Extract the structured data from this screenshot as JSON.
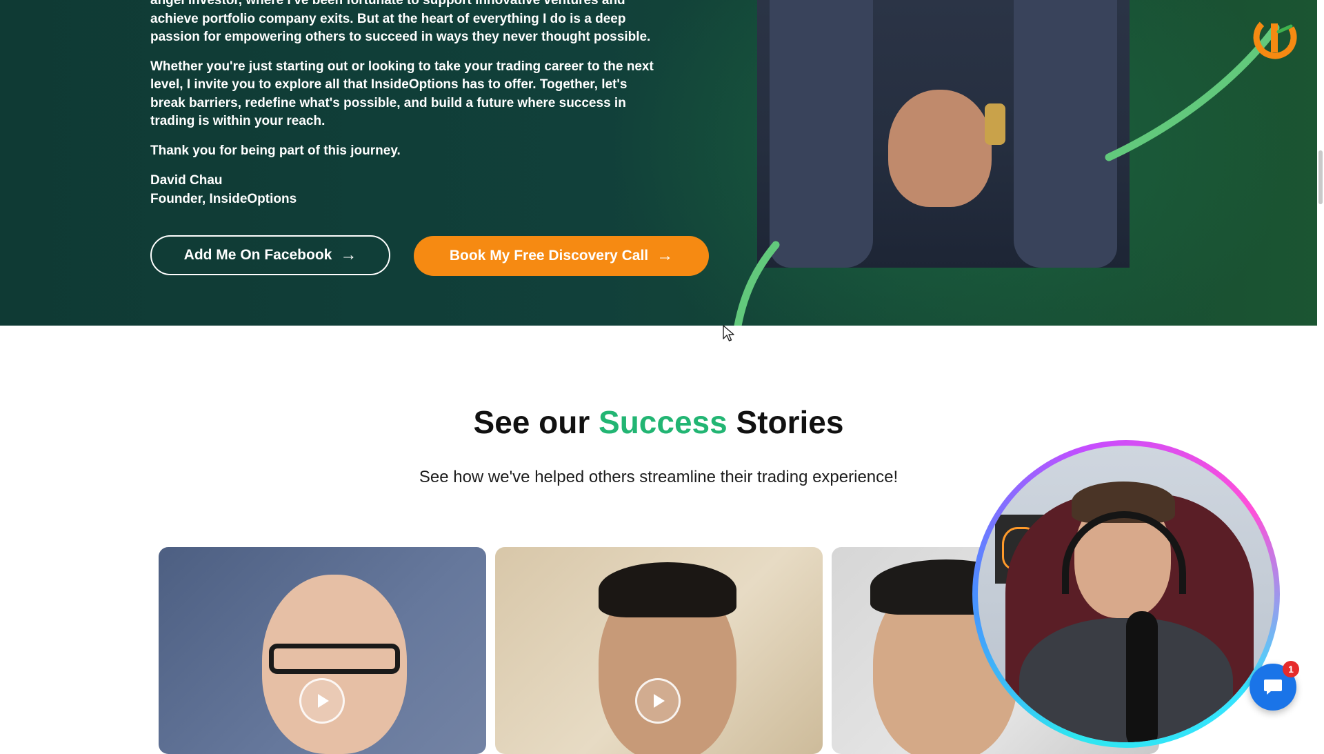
{
  "hero": {
    "paragraphs": [
      "angel investor, where I've been fortunate to support innovative ventures and achieve portfolio company exits. But at the heart of everything I do is a deep passion for empowering others to succeed in ways they never thought possible.",
      "Whether you're just starting out or looking to take your trading career to the next level, I invite you to explore all that InsideOptions has to offer. Together, let's break barriers, redefine what's possible, and build a future where success in trading is within your reach.",
      "Thank you for being part of this journey."
    ],
    "signature_name": "David Chau",
    "signature_title": "Founder, InsideOptions",
    "facebook_button": "Add Me On Facebook",
    "discovery_button": "Book My Free Discovery Call",
    "button_arrow": "→",
    "colors": {
      "background": "#11403a",
      "accent_orange": "#f68a12",
      "curve_green": "#62c97c"
    }
  },
  "stories": {
    "title_before": "See our ",
    "title_accent": "Success",
    "title_after": " Stories",
    "subtitle": "See how we've helped others streamline their trading experience!",
    "accent_color": "#22b573",
    "videos": [
      {
        "icon": "play-icon"
      },
      {
        "icon": "play-icon"
      },
      {
        "icon": "none"
      }
    ]
  },
  "chat": {
    "icon": "chat-bubble-icon",
    "badge_count": "1",
    "color": "#1a74e8"
  },
  "logo": {
    "icon": "brand-logo-icon"
  }
}
